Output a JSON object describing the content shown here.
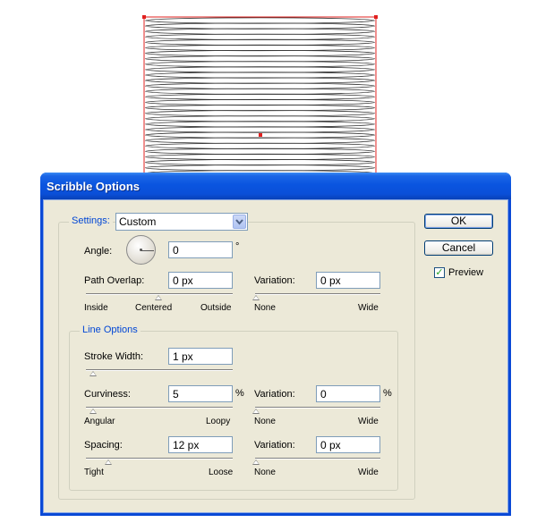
{
  "dialog": {
    "title": "Scribble Options",
    "ok_label": "OK",
    "cancel_label": "Cancel",
    "preview_label": "Preview",
    "preview_checked": true
  },
  "settings": {
    "legend": "Settings:",
    "selected": "Custom",
    "angle_label": "Angle:",
    "angle_value": "0",
    "angle_unit": "°",
    "path_overlap_label": "Path Overlap:",
    "path_overlap_value": "0 px",
    "path_overlap_slider": {
      "min_label": "Inside",
      "mid_label": "Centered",
      "max_label": "Outside",
      "position": 0.5
    },
    "variation_label": "Variation:",
    "overlap_variation_value": "0 px",
    "overlap_variation_slider": {
      "min_label": "None",
      "max_label": "Wide",
      "position": 0.0
    }
  },
  "line_options": {
    "legend": "Line Options",
    "stroke_width_label": "Stroke Width:",
    "stroke_width_value": "1 px",
    "stroke_width_slider_position": 0.05,
    "curviness_label": "Curviness:",
    "curviness_value": "5",
    "curviness_unit": "%",
    "curviness_slider": {
      "min_label": "Angular",
      "max_label": "Loopy",
      "position": 0.05
    },
    "curviness_variation_label": "Variation:",
    "curviness_variation_value": "0",
    "curviness_variation_unit": "%",
    "curviness_variation_slider": {
      "min_label": "None",
      "max_label": "Wide",
      "position": 0.0
    },
    "spacing_label": "Spacing:",
    "spacing_value": "12 px",
    "spacing_slider": {
      "min_label": "Tight",
      "max_label": "Loose",
      "position": 0.16
    },
    "spacing_variation_label": "Variation:",
    "spacing_variation_value": "0 px",
    "spacing_variation_slider": {
      "min_label": "None",
      "max_label": "Wide",
      "position": 0.0
    }
  },
  "colors": {
    "selection": "#e0201f",
    "scribble": "#333333",
    "titlebar": "#0a55e0",
    "legend_text": "#0046d5"
  }
}
